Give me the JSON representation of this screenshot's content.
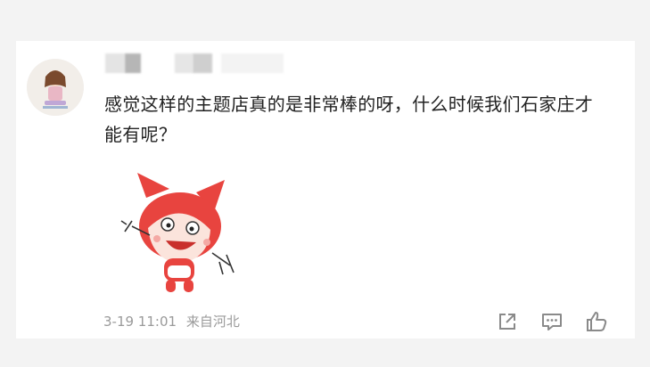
{
  "comment": {
    "text": "感觉这样的主题店真的是非常棒的呀，什么时候我们石家庄才能有呢？",
    "time": "3-19 11:01",
    "location": "来自河北"
  },
  "icons": {
    "share": "share-icon",
    "reply": "comment-icon",
    "like": "thumbs-up-icon"
  },
  "colors": {
    "sticker_red": "#e8443f",
    "meta_gray": "#9a9a9a"
  }
}
